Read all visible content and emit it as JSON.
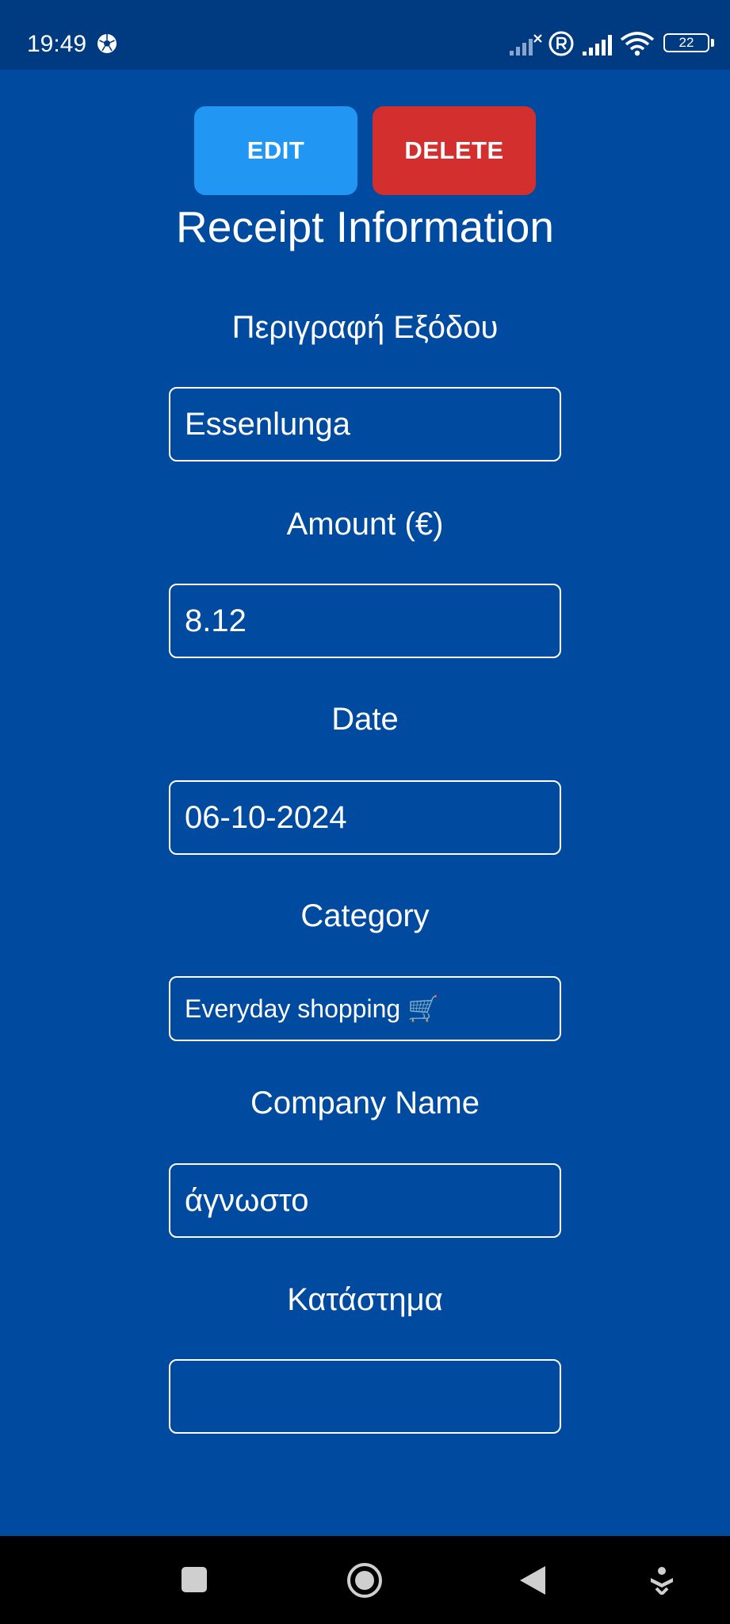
{
  "status_bar": {
    "time": "19:49",
    "battery": "22",
    "icons": [
      "soccer-ball-icon",
      "signal-muted-icon",
      "registered-icon",
      "signal-icon",
      "wifi-icon",
      "battery-icon"
    ]
  },
  "actions": {
    "edit_label": "EDIT",
    "delete_label": "DELETE"
  },
  "title": "Receipt Information",
  "fields": {
    "description": {
      "label": "Περιγραφή Εξόδου",
      "value": "Essenlunga"
    },
    "amount": {
      "label": "Amount (€)",
      "value": "8.12"
    },
    "date": {
      "label": "Date",
      "value": "06-10-2024"
    },
    "category": {
      "label": "Category",
      "value": "Everyday shopping 🛒"
    },
    "company": {
      "label": "Company Name",
      "value": "άγνωστο"
    },
    "store": {
      "label": "Κατάστημα",
      "value": ""
    }
  },
  "nav_bar": {
    "icons": [
      "recents-square-icon",
      "home-circle-icon",
      "back-triangle-icon",
      "accessibility-icon"
    ]
  },
  "colors": {
    "background": "#004aa0",
    "status_bar": "#003a80",
    "edit_button": "#2196f3",
    "delete_button": "#d32f2f",
    "text": "#ffffff"
  }
}
